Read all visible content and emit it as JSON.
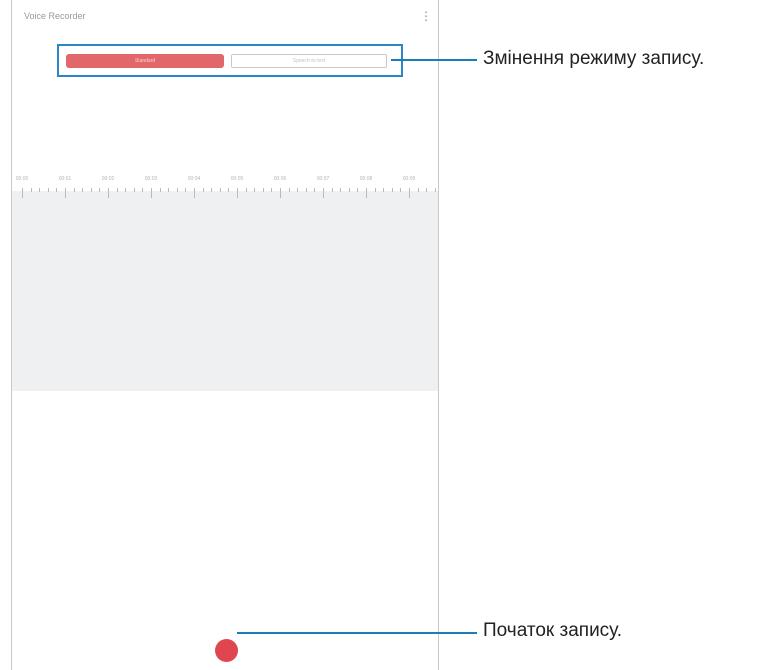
{
  "app": {
    "title": "Voice Recorder"
  },
  "header": {
    "more_icon": "more-vertical-icon"
  },
  "mode_selector": {
    "active_label": "Standard",
    "inactive_label": "Speech-to-text"
  },
  "timeline": {
    "labels": [
      "00:00",
      "00:01",
      "00:02",
      "00:03",
      "00:04",
      "00:05",
      "00:06",
      "00:07",
      "00:08",
      "00:09"
    ]
  },
  "record": {
    "icon": "record-icon"
  },
  "callouts": {
    "mode_change": "Змінення режиму запису.",
    "start_recording": "Початок запису."
  },
  "colors": {
    "accent": "#e2676b",
    "record": "#e04650",
    "callout": "#1a7cb9"
  }
}
